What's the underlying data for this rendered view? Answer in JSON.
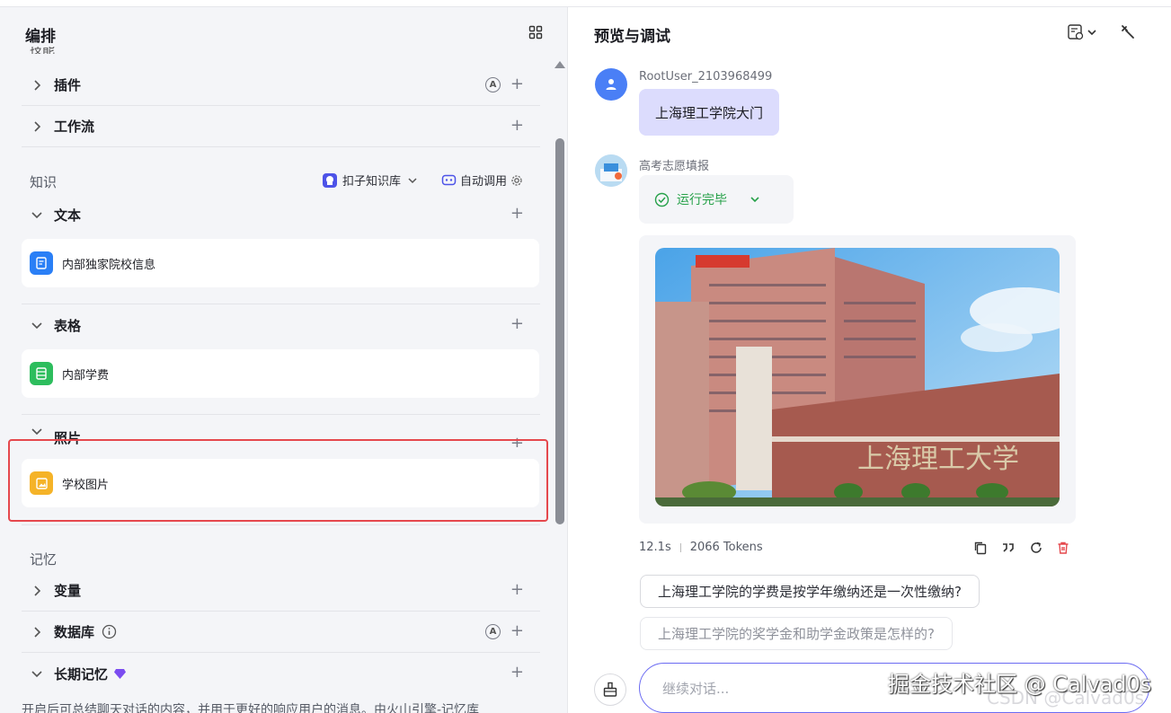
{
  "left": {
    "title": "编排",
    "cut_section": "技能",
    "skills": [
      {
        "label": "插件"
      },
      {
        "label": "工作流"
      }
    ],
    "knowledge": {
      "title": "知识",
      "kb_selector": "扣子知识库",
      "auto_call": "自动调用",
      "groups": [
        {
          "label": "文本",
          "item": "内部独家院校信息",
          "color": "#2a7ff6"
        },
        {
          "label": "表格",
          "item": "内部学费",
          "color": "#2dbd5d"
        },
        {
          "label": "照片",
          "item": "学校图片",
          "color": "#f5b328"
        }
      ]
    },
    "memory": {
      "title": "记忆",
      "variables": "变量",
      "database": "数据库",
      "long_term": "长期记忆",
      "description": "开启后可总结聊天对话的内容，并用于更好的响应用户的消息。由火山引擎-记忆库"
    }
  },
  "right": {
    "title": "预览与调试",
    "user": {
      "name": "RootUser_2103968499",
      "message": "上海理工学院大门"
    },
    "bot": {
      "name": "高考志愿填报",
      "status": "运行完毕",
      "photo_sign": "上海理工大学",
      "time": "12.1s",
      "tokens": "2066 Tokens"
    },
    "suggestions": [
      "上海理工学院的学费是按学年缴纳还是一次性缴纳?",
      "上海理工学院的奖学金和助学金政策是怎样的?"
    ],
    "input_placeholder": "继续对话..."
  },
  "watermark": {
    "main": "掘金技术社区 @ Calvad0s",
    "sub": "CSDN @Calvad0s"
  }
}
